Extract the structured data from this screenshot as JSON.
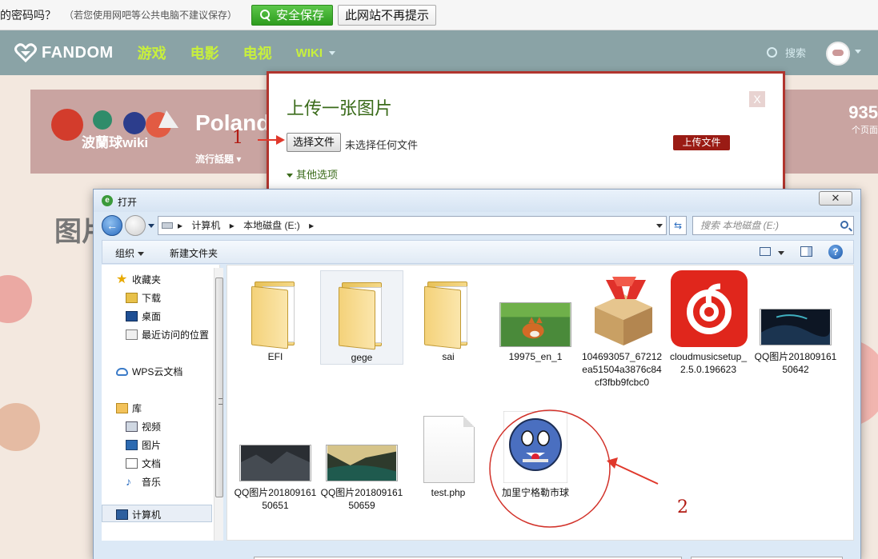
{
  "password_bar": {
    "question": "的密码吗？",
    "hint": "（若您使用网吧等公共电脑不建议保存）",
    "save_button": "安全保存",
    "never_button": "此网站不再提示"
  },
  "fandom_nav": {
    "logo": "FANDOM",
    "items": [
      "游戏",
      "电影",
      "电视"
    ],
    "wiki": "WIKI",
    "search": "搜索"
  },
  "community": {
    "wiki_name": "波蘭球wiki",
    "title": "Poland",
    "trending": "流行話題",
    "pages_count": "935",
    "pages_label": "个页面"
  },
  "page_heading": "图片",
  "upload_dialog": {
    "title": "上传一张图片",
    "close": "X",
    "choose_file": "选择文件",
    "no_file": "未选择任何文件",
    "upload_button": "上传文件",
    "more_options": "其他选项"
  },
  "annotations": {
    "step1": "1",
    "step2": "2"
  },
  "file_dialog": {
    "title": "打开",
    "close": "✕",
    "breadcrumbs": [
      "计算机",
      "本地磁盘 (E:)"
    ],
    "search_placeholder": "搜索 本地磁盘 (E:)",
    "toolbar": {
      "organize": "组织",
      "new_folder": "新建文件夹"
    },
    "sidebar": {
      "favorites": "收藏夹",
      "downloads": "下载",
      "desktop": "桌面",
      "recent": "最近访问的位置",
      "wps": "WPS云文档",
      "library": "库",
      "videos": "视频",
      "pictures": "图片",
      "documents": "文档",
      "music": "音乐",
      "computer": "计算机"
    },
    "files": [
      {
        "name": "EFI",
        "kind": "folder"
      },
      {
        "name": "gege",
        "kind": "folder"
      },
      {
        "name": "sai",
        "kind": "folder"
      },
      {
        "name": "19975_en_1",
        "kind": "image-fox"
      },
      {
        "name": "104693057_67212ea51504a3876c84cf3fbb9fcbc0",
        "kind": "winrar"
      },
      {
        "name": "cloudmusicsetup_2.5.0.196623",
        "kind": "netease"
      },
      {
        "name": "QQ图片20180916150642",
        "kind": "image-night"
      },
      {
        "name": "QQ图片20180916150651",
        "kind": "image-dark"
      },
      {
        "name": "QQ图片20180916150659",
        "kind": "image-valley"
      },
      {
        "name": "test.php",
        "kind": "php"
      },
      {
        "name": "加里宁格勒市球",
        "kind": "countryball"
      }
    ]
  },
  "colors": {
    "accent_green": "#c8f03c",
    "fandom_bar": "#8aa3a6",
    "upload_border": "#b1352e",
    "annotation_red": "#b21a12"
  }
}
